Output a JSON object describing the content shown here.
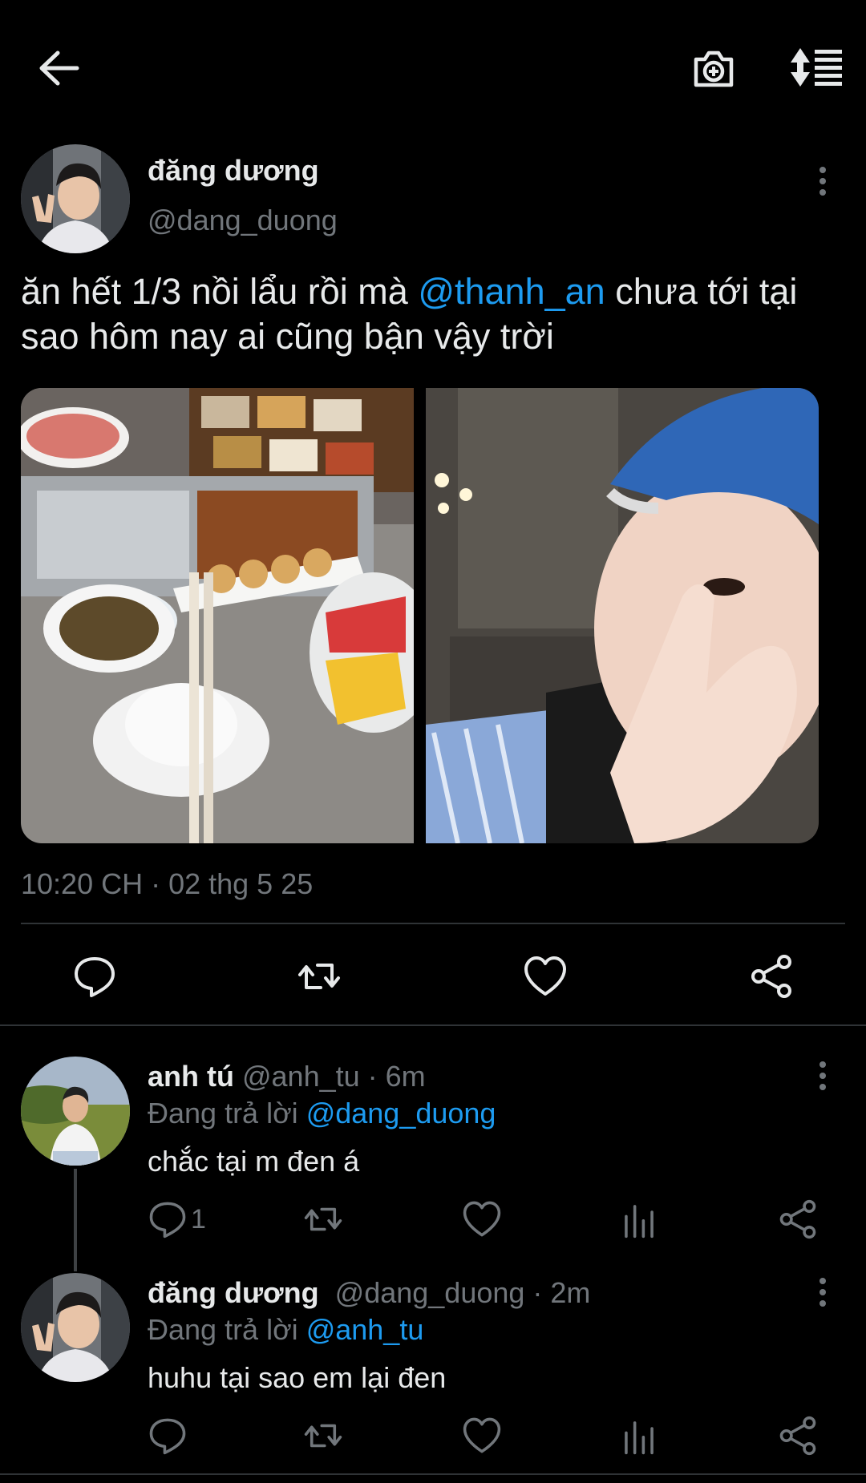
{
  "top_bar": {
    "back_icon": "arrow-left-icon",
    "camera_icon": "camera-plus-icon",
    "sort_icon": "sort-list-icon"
  },
  "main_tweet": {
    "author_name": "đăng dương",
    "author_handle": "@dang_duong",
    "text_part1": "ăn hết 1/3 nồi lẩu rồi mà ",
    "mention": "@thanh_an",
    "text_part2": " chưa tới tại sao hôm nay ai cũng bận vậy trời",
    "timestamp": "10:20 CH · 02 thg 5 25",
    "actions": [
      "reply-icon",
      "retweet-icon",
      "like-icon",
      "share-icon"
    ]
  },
  "replies": [
    {
      "author_name": "anh tú",
      "meta": " @anh_tu · 6m",
      "replying_label": "Đang trả lời ",
      "replying_to": "@dang_duong",
      "text": "chắc tại m đen á",
      "reply_count": "1"
    },
    {
      "author_name": "đăng dương",
      "meta": "  @dang_duong · 2m",
      "replying_label": "Đang trả lời ",
      "replying_to": "@anh_tu",
      "text": "huhu tại sao em lại đen",
      "reply_count": ""
    }
  ],
  "colors": {
    "background": "#000000",
    "text": "#e7e9ea",
    "muted": "#71767b",
    "link": "#1d9bf0",
    "divider": "#2f3336"
  }
}
